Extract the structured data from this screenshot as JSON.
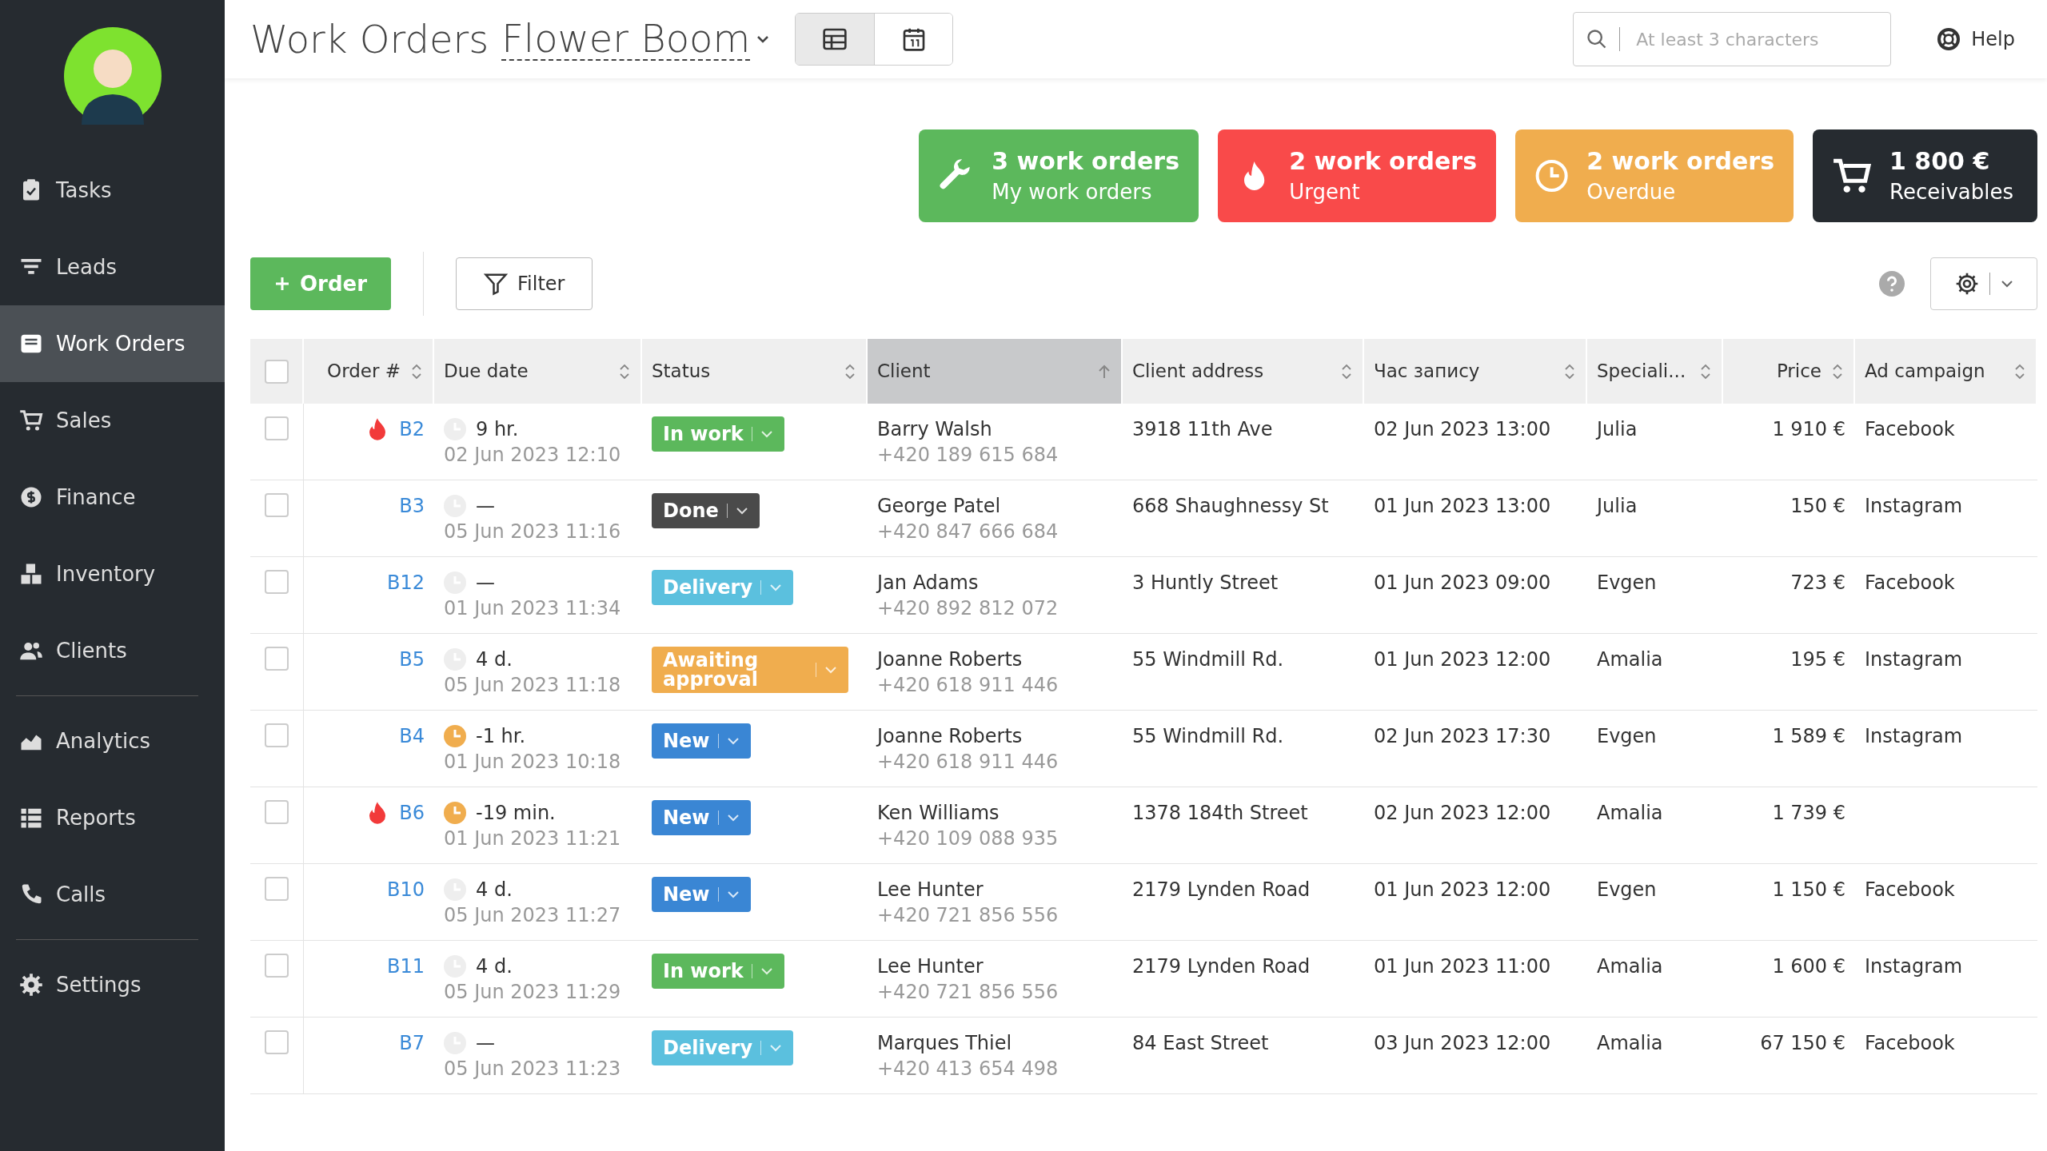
{
  "sidebar": {
    "groups": [
      [
        {
          "label": "Tasks",
          "selected": false
        },
        {
          "label": "Leads",
          "selected": false
        },
        {
          "label": "Work Orders",
          "selected": true
        },
        {
          "label": "Sales",
          "selected": false
        },
        {
          "label": "Finance",
          "selected": false
        },
        {
          "label": "Inventory",
          "selected": false
        },
        {
          "label": "Clients",
          "selected": false
        }
      ],
      [
        {
          "label": "Analytics",
          "selected": false
        },
        {
          "label": "Reports",
          "selected": false
        },
        {
          "label": "Calls",
          "selected": false
        }
      ],
      [
        {
          "label": "Settings",
          "selected": false
        }
      ]
    ]
  },
  "header": {
    "title": "Work Orders",
    "company": "Flower Boom",
    "views": [
      {
        "kind": "table",
        "selected": true
      },
      {
        "kind": "calendar",
        "selected": false
      }
    ],
    "search": {
      "placeholder": "At least 3 characters"
    },
    "help": "Help"
  },
  "stats": [
    {
      "kind": "mine",
      "value": "3 work orders",
      "label": "My work orders"
    },
    {
      "kind": "urgent",
      "value": "2 work orders",
      "label": "Urgent"
    },
    {
      "kind": "overdue",
      "value": "2 work orders",
      "label": "Overdue"
    },
    {
      "kind": "receivables",
      "value": "1 800 €",
      "label": "Receivables"
    }
  ],
  "toolbar": {
    "add_button": "Order",
    "filter_button": "Filter"
  },
  "table": {
    "select_all": false,
    "columns": [
      {
        "label": "Order #",
        "sorted": false
      },
      {
        "label": "Due date",
        "sorted": false
      },
      {
        "label": "Status",
        "sorted": false
      },
      {
        "label": "Client",
        "sorted": true
      },
      {
        "label": "Client address",
        "sorted": false
      },
      {
        "label": "Час запису",
        "sorted": false
      },
      {
        "label": "Speciali...",
        "sorted": false
      },
      {
        "label": "Price",
        "sorted": false
      },
      {
        "label": "Ad campaign",
        "sorted": false
      }
    ],
    "rows": [
      {
        "checked": false,
        "urgent": true,
        "order": "B2",
        "overdue": false,
        "due": "9 hr.",
        "due_date": "02 Jun 2023 12:10",
        "status": {
          "kind": "in_work",
          "label": "In work"
        },
        "client": "Barry Walsh",
        "phone": "+420 189 615 684",
        "address": "3918 11th Ave",
        "time": "02 Jun 2023 13:00",
        "specialist": "Julia",
        "price": "1 910 €",
        "campaign": "Facebook"
      },
      {
        "checked": false,
        "urgent": false,
        "order": "B3",
        "overdue": false,
        "due": "—",
        "due_date": "05 Jun 2023 11:16",
        "status": {
          "kind": "done",
          "label": "Done"
        },
        "client": "George Patel",
        "phone": "+420 847 666 684",
        "address": "668 Shaughnessy St",
        "time": "01 Jun 2023 13:00",
        "specialist": "Julia",
        "price": "150 €",
        "campaign": "Instagram"
      },
      {
        "checked": false,
        "urgent": false,
        "order": "B12",
        "overdue": false,
        "due": "—",
        "due_date": "01 Jun 2023 11:34",
        "status": {
          "kind": "delivery",
          "label": "Delivery"
        },
        "client": "Jan Adams",
        "phone": "+420 892 812 072",
        "address": "3 Huntly Street",
        "time": "01 Jun 2023 09:00",
        "specialist": "Evgen",
        "price": "723 €",
        "campaign": "Facebook"
      },
      {
        "checked": false,
        "urgent": false,
        "order": "B5",
        "overdue": false,
        "due": "4 d.",
        "due_date": "05 Jun 2023 11:18",
        "status": {
          "kind": "awaiting",
          "label": "Awaiting approval"
        },
        "client": "Joanne Roberts",
        "phone": "+420 618 911 446",
        "address": "55 Windmill Rd.",
        "time": "01 Jun 2023 12:00",
        "specialist": "Amalia",
        "price": "195 €",
        "campaign": "Instagram"
      },
      {
        "checked": false,
        "urgent": false,
        "order": "B4",
        "overdue": true,
        "due": "-1 hr.",
        "due_date": "01 Jun 2023 10:18",
        "status": {
          "kind": "new",
          "label": "New"
        },
        "client": "Joanne Roberts",
        "phone": "+420 618 911 446",
        "address": "55 Windmill Rd.",
        "time": "02 Jun 2023 17:30",
        "specialist": "Evgen",
        "price": "1 589 €",
        "campaign": "Instagram"
      },
      {
        "checked": false,
        "urgent": true,
        "order": "B6",
        "overdue": true,
        "due": "-19 min.",
        "due_date": "01 Jun 2023 11:21",
        "status": {
          "kind": "new",
          "label": "New"
        },
        "client": "Ken Williams",
        "phone": "+420 109 088 935",
        "address": "1378 184th Street",
        "time": "02 Jun 2023 12:00",
        "specialist": "Amalia",
        "price": "1 739 €"
      },
      {
        "checked": false,
        "urgent": false,
        "order": "B10",
        "overdue": false,
        "due": "4 d.",
        "due_date": "05 Jun 2023 11:27",
        "status": {
          "kind": "new",
          "label": "New"
        },
        "client": "Lee Hunter",
        "phone": "+420 721 856 556",
        "address": "2179 Lynden Road",
        "time": "01 Jun 2023 12:00",
        "specialist": "Evgen",
        "price": "1 150 €",
        "campaign": "Facebook"
      },
      {
        "checked": false,
        "urgent": false,
        "order": "B11",
        "overdue": false,
        "due": "4 d.",
        "due_date": "05 Jun 2023 11:29",
        "status": {
          "kind": "in_work",
          "label": "In work"
        },
        "client": "Lee Hunter",
        "phone": "+420 721 856 556",
        "address": "2179 Lynden Road",
        "time": "01 Jun 2023 11:00",
        "specialist": "Amalia",
        "price": "1 600 €",
        "campaign": "Instagram"
      },
      {
        "checked": false,
        "urgent": false,
        "order": "B7",
        "overdue": false,
        "due": "—",
        "due_date": "05 Jun 2023 11:23",
        "status": {
          "kind": "delivery",
          "label": "Delivery"
        },
        "client": "Marques Thiel",
        "phone": "+420 413 654 498",
        "address": "84 East Street",
        "time": "03 Jun 2023 12:00",
        "specialist": "Amalia",
        "price": "67 150 €",
        "campaign": "Facebook"
      }
    ]
  }
}
